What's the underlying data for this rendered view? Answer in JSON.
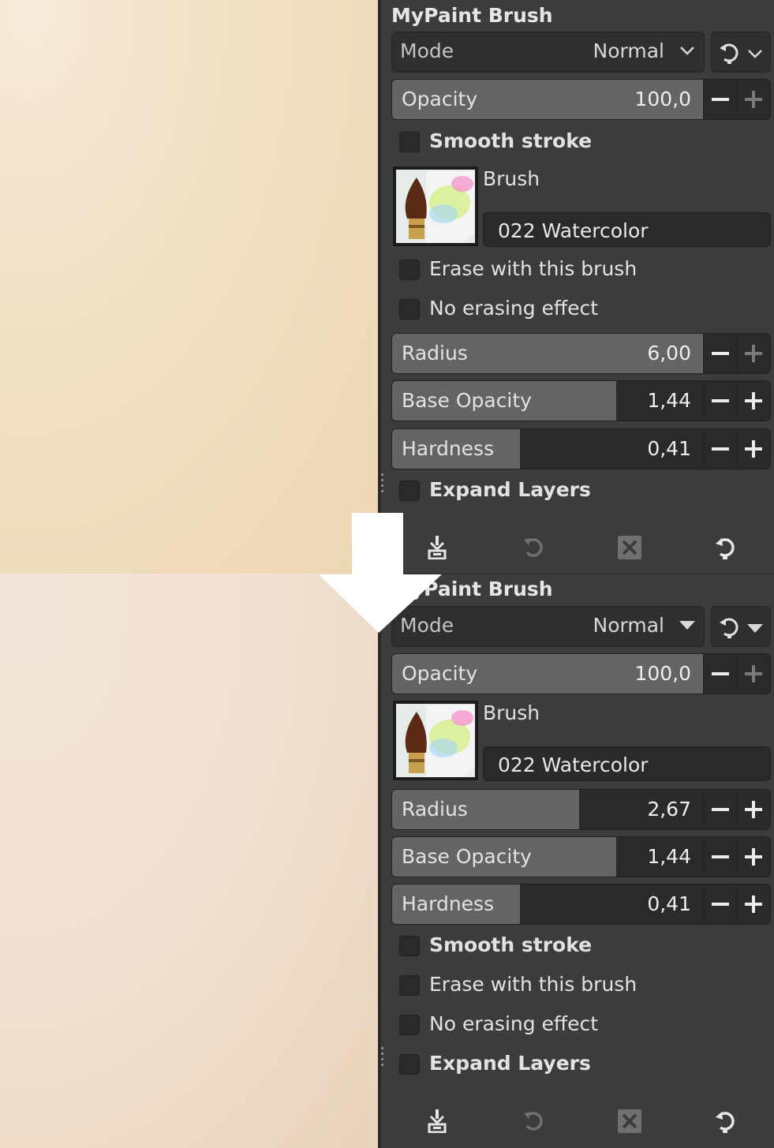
{
  "options_top": {
    "title": "MyPaint Brush",
    "mode_label": "Mode",
    "mode_value": "Normal",
    "opacity": {
      "label": "Opacity",
      "value": "100,0",
      "fill": 1.0
    },
    "smooth_stroke": "Smooth stroke",
    "brush_label": "Brush",
    "brush_name": "022 Watercolor",
    "erase_with_brush": "Erase with this brush",
    "no_erasing_effect": "No erasing effect",
    "radius": {
      "label": "Radius",
      "value": "6,00",
      "fill": 1.0
    },
    "base_opacity": {
      "label": "Base Opacity",
      "value": "1,44",
      "fill": 0.72
    },
    "hardness": {
      "label": "Hardness",
      "value": "0,41",
      "fill": 0.41
    },
    "expand_layers": "Expand Layers"
  },
  "options_bottom": {
    "title": "MyPaint Brush",
    "mode_label": "Mode",
    "mode_value": "Normal",
    "opacity": {
      "label": "Opacity",
      "value": "100,0",
      "fill": 1.0
    },
    "brush_label": "Brush",
    "brush_name": "022 Watercolor",
    "radius": {
      "label": "Radius",
      "value": "2,67",
      "fill": 0.6
    },
    "base_opacity": {
      "label": "Base Opacity",
      "value": "1,44",
      "fill": 0.72
    },
    "hardness": {
      "label": "Hardness",
      "value": "0,41",
      "fill": 0.41
    },
    "smooth_stroke": "Smooth stroke",
    "erase_with_brush": "Erase with this brush",
    "no_erasing_effect": "No erasing effect",
    "expand_layers": "Expand Layers"
  },
  "footer_icons": [
    "save-preset-icon",
    "restore-icon",
    "delete-icon",
    "reset-icon"
  ],
  "colors": {
    "panel_bg": "#3c3c3c",
    "slider_fill": "#646464",
    "canvas_top": "#eed7b3",
    "canvas_bottom": "#ead3bb"
  }
}
